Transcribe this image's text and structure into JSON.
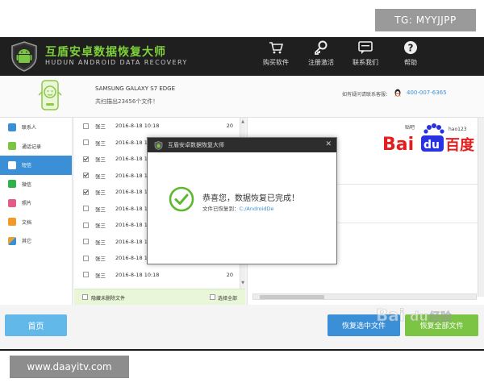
{
  "watermarks": {
    "tg": "TG: MYYJJPP",
    "site": "www.daayitv.com"
  },
  "app": {
    "title": "互盾安卓数据恢复大师",
    "subtitle": "HUDUN ANDROID DATA RECOVERY",
    "toolbar": [
      {
        "label": "购买软件",
        "icon": "cart-icon"
      },
      {
        "label": "注册激活",
        "icon": "key-icon"
      },
      {
        "label": "联系我们",
        "icon": "chat-icon"
      },
      {
        "label": "帮助",
        "icon": "help-icon"
      }
    ]
  },
  "device": {
    "name": "SAMSUNG GALAXY S7 EDGE",
    "count_text": "共扫描出23456个文件！",
    "contact_label": "如有疑问请联系客服：",
    "phone": "400-007-6365"
  },
  "sidebar": {
    "items": [
      {
        "label": "联系人",
        "color": "#3b8fd6"
      },
      {
        "label": "通话记录",
        "color": "#7cc443"
      },
      {
        "label": "短信",
        "color": "#ffffff",
        "active": true
      },
      {
        "label": "微信",
        "color": "#2fb24a"
      },
      {
        "label": "照片",
        "color": "#e25b8c"
      },
      {
        "label": "文档",
        "color": "#f09a2a"
      },
      {
        "label": "其它",
        "color": "#e2a13b"
      }
    ]
  },
  "list": {
    "rows": [
      {
        "name": "张三",
        "date": "2016-8-18 10:18",
        "size": "20",
        "checked": false
      },
      {
        "name": "张三",
        "date": "2016-8-18 10:18",
        "size": "",
        "checked": false
      },
      {
        "name": "张三",
        "date": "2016-8-18 10:18",
        "size": "",
        "checked": true
      },
      {
        "name": "张三",
        "date": "2016-8-18 10:18",
        "size": "",
        "checked": true
      },
      {
        "name": "张三",
        "date": "2016-8-18 10:18",
        "size": "",
        "checked": true
      },
      {
        "name": "张三",
        "date": "2016-8-18 10:18",
        "size": "",
        "checked": false
      },
      {
        "name": "张三",
        "date": "2016-8-18 10:18",
        "size": "",
        "checked": false
      },
      {
        "name": "张三",
        "date": "2016-8-18 10:18",
        "size": "",
        "checked": false
      },
      {
        "name": "张三",
        "date": "2016-8-18 10:18",
        "size": "",
        "checked": false
      },
      {
        "name": "张三",
        "date": "2016-8-18 10:18",
        "size": "20",
        "checked": false
      }
    ],
    "footer": {
      "hide_deleted": "隐藏未删除文件",
      "select_all": "选择全部"
    }
  },
  "baidu_logo": {
    "text1": "Bai",
    "text2": "du",
    "text3": "百度",
    "small": "贴吧",
    "hao": "hao123"
  },
  "buttons": {
    "home": "首页",
    "recover_selected": "恢复选中文件",
    "recover_all": "恢复全部文件"
  },
  "dialog": {
    "title": "互盾安卓数据恢复大师",
    "close": "✕",
    "message": "恭喜您，数据恢复已完成！",
    "path_label": "文件已恢复到：",
    "path": "C:/AndroidDe"
  },
  "colors": {
    "accent_blue": "#3b8fd6",
    "accent_green": "#7cc443",
    "titlebar": "#1f1f1f"
  }
}
